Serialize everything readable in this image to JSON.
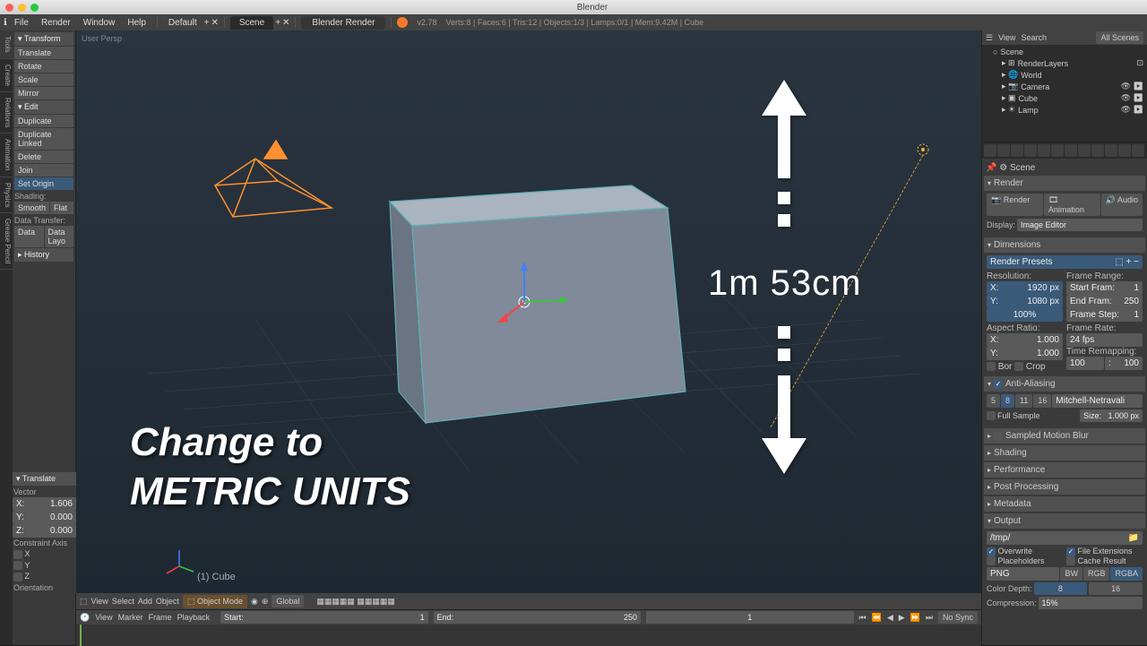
{
  "titlebar": {
    "title": "Blender"
  },
  "menubar": {
    "items": [
      "File",
      "Render",
      "Window",
      "Help"
    ],
    "layout": "Default",
    "scene": "Scene",
    "engine": "Blender Render",
    "version": "v2.78",
    "stats": "Verts:8 | Faces:6 | Tris:12 | Objects:1/3 | Lamps:0/1 | Mem:9.42M | Cube"
  },
  "side_tabs": [
    "Tools",
    "Create",
    "Relations",
    "Animation",
    "Physics",
    "Grease Pencil"
  ],
  "toolshelf": {
    "transform_h": "Transform",
    "translate": "Translate",
    "rotate": "Rotate",
    "scale": "Scale",
    "mirror": "Mirror",
    "edit_h": "Edit",
    "duplicate": "Duplicate",
    "duplicate_linked": "Duplicate Linked",
    "delete": "Delete",
    "join": "Join",
    "set_origin": "Set Origin",
    "shading_h": "Shading:",
    "smooth": "Smooth",
    "flat": "Flat",
    "data_transfer_h": "Data Transfer:",
    "data": "Data",
    "data_layo": "Data Layo",
    "history_h": "History"
  },
  "viewport": {
    "info": "User Persp",
    "obj_label": "(1) Cube"
  },
  "overlay": {
    "line1": "Change to",
    "line2": "METRIC UNITS",
    "measure": "1m 53cm"
  },
  "vp_header": {
    "menus": [
      "View",
      "Select",
      "Add",
      "Object"
    ],
    "mode": "Object Mode",
    "orient": "Global"
  },
  "translate_panel": {
    "h": "Translate",
    "vector": "Vector",
    "x_l": "X:",
    "x_v": "1.606",
    "y_l": "Y:",
    "y_v": "0.000",
    "z_l": "Z:",
    "z_v": "0.000",
    "constraint": "Constraint Axis",
    "cx": "X",
    "cy": "Y",
    "cz": "Z",
    "orient": "Orientation"
  },
  "timeline": {
    "menus": [
      "View",
      "Marker",
      "Frame",
      "Playback"
    ],
    "start_l": "Start:",
    "start_v": "1",
    "end_l": "End:",
    "end_v": "250",
    "cur": "1",
    "sync": "No Sync"
  },
  "outliner": {
    "menus": [
      "View",
      "Search"
    ],
    "filter": "All Scenes",
    "scene": "Scene",
    "renderlayers": "RenderLayers",
    "world": "World",
    "camera": "Camera",
    "cube": "Cube",
    "lamp": "Lamp"
  },
  "props": {
    "context": "Scene",
    "render_h": "Render",
    "render": "Render",
    "animation": "Animation",
    "audio": "Audio",
    "display_l": "Display:",
    "display_v": "Image Editor",
    "dimensions_h": "Dimensions",
    "presets": "Render Presets",
    "resolution_l": "Resolution:",
    "frame_range_l": "Frame Range:",
    "res_x_l": "X:",
    "res_x_v": "1920 px",
    "res_y_l": "Y:",
    "res_y_v": "1080 px",
    "res_pct": "100%",
    "fr_start_l": "Start Fram:",
    "fr_start_v": "1",
    "fr_end_l": "End Fram:",
    "fr_end_v": "250",
    "fr_step_l": "Frame Step:",
    "fr_step_v": "1",
    "aspect_l": "Aspect Ratio:",
    "frame_rate_l": "Frame Rate:",
    "asp_x_l": "X:",
    "asp_x_v": "1.000",
    "asp_y_l": "Y:",
    "asp_y_v": "1.000",
    "fps": "24 fps",
    "remap_l": "Time Remapping:",
    "remap_old": "100",
    "remap_new": "100",
    "border": "Bor",
    "crop": "Crop",
    "aa_h": "Anti-Aliasing",
    "aa_5": "5",
    "aa_8": "8",
    "aa_11": "11",
    "aa_16": "16",
    "aa_filter": "Mitchell-Netravali",
    "full_sample": "Full Sample",
    "size_l": "Size:",
    "size_v": "1.000 px",
    "mblur_h": "Sampled Motion Blur",
    "shading_h": "Shading",
    "perf_h": "Performance",
    "post_h": "Post Processing",
    "meta_h": "Metadata",
    "output_h": "Output",
    "output_path": "/tmp/",
    "overwrite": "Overwrite",
    "file_ext": "File Extensions",
    "placeholders": "Placeholders",
    "cache": "Cache Result",
    "format": "PNG",
    "bw": "BW",
    "rgb": "RGB",
    "rgba": "RGBA",
    "depth_l": "Color Depth:",
    "d8": "8",
    "d16": "16",
    "compress_l": "Compression:",
    "compress_v": "15%"
  }
}
